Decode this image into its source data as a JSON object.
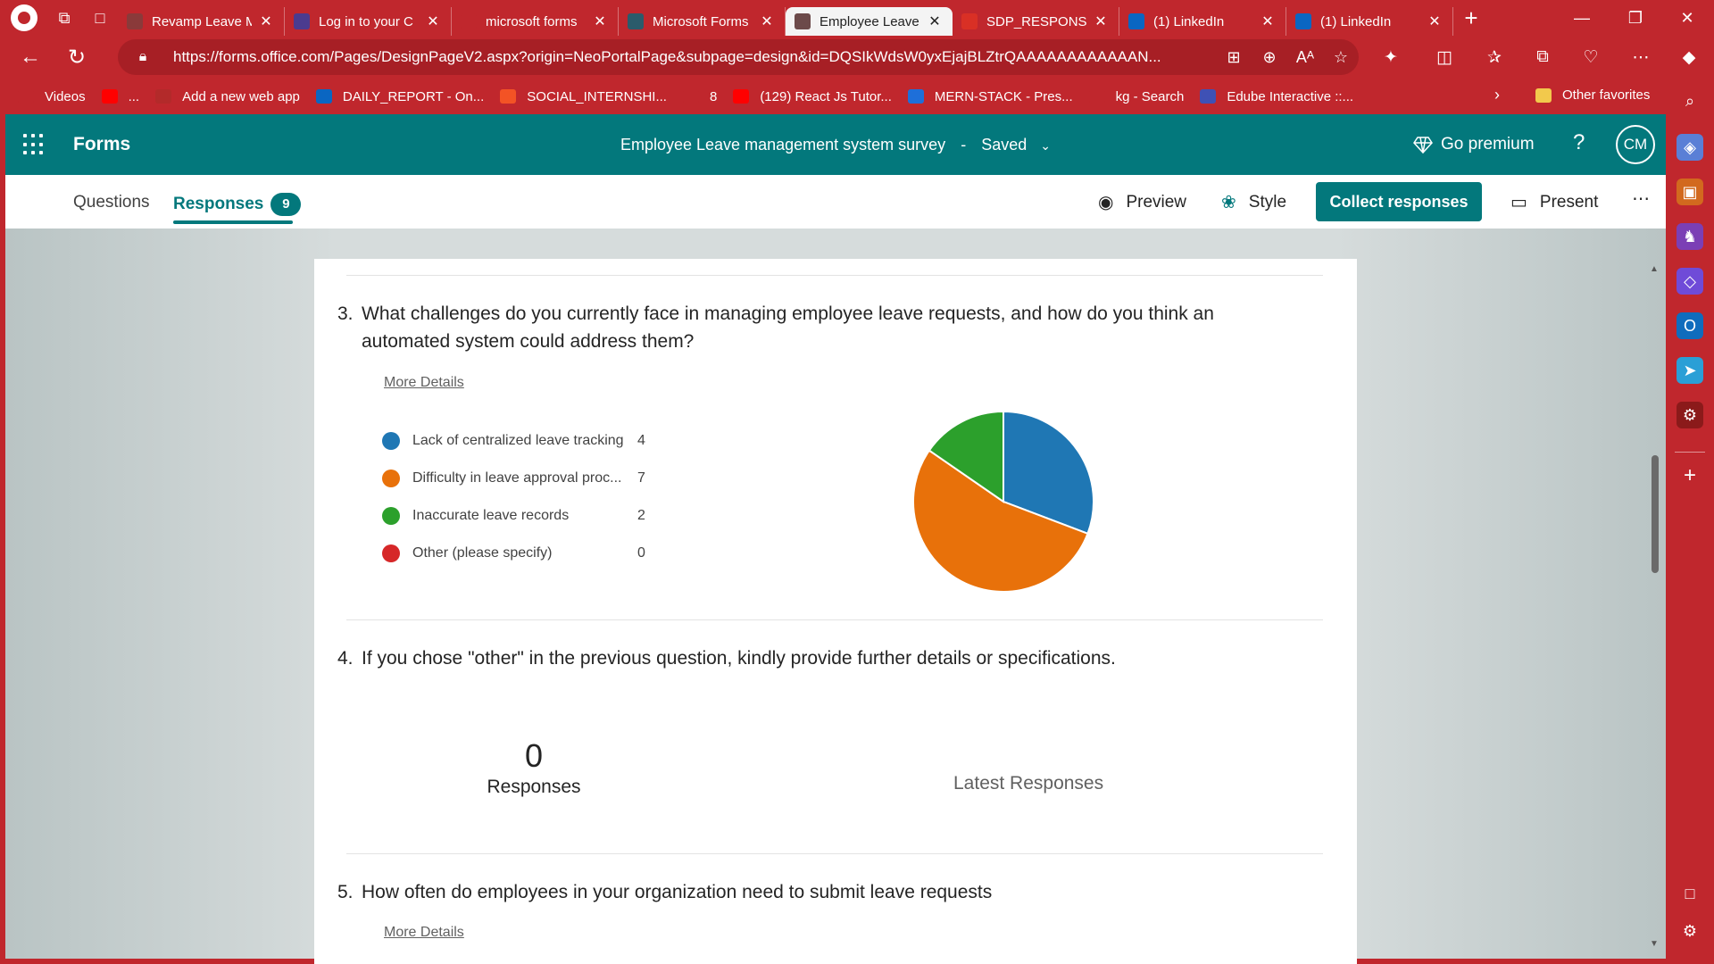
{
  "browser": {
    "tabs": [
      {
        "title": "Revamp Leave M",
        "favicon_color": "#8a3a3a",
        "active": false
      },
      {
        "title": "Log in to your C",
        "favicon_color": "#4b3b8f",
        "active": false
      },
      {
        "title": "microsoft forms",
        "favicon_color": "#c0272d",
        "active": false
      },
      {
        "title": "Microsoft Forms",
        "favicon_color": "#2b5b6b",
        "active": false
      },
      {
        "title": "Employee Leave",
        "favicon_color": "#6c4a4a",
        "active": true
      },
      {
        "title": "SDP_RESPONSE",
        "favicon_color": "#d93025",
        "active": false
      },
      {
        "title": "(1) LinkedIn",
        "favicon_color": "#0a66c2",
        "active": false
      },
      {
        "title": "(1) LinkedIn",
        "favicon_color": "#0a66c2",
        "active": false
      }
    ],
    "url": "https://forms.office.com/Pages/DesignPageV2.aspx?origin=NeoPortalPage&subpage=design&id=DQSIkWdsW0yxEjajBLZtrQAAAAAAAAAAAAN...",
    "favorites": [
      {
        "label": "Videos",
        "icon_color": "#c0272d"
      },
      {
        "label": "...",
        "icon_color": "#ff0000"
      },
      {
        "label": "Add a new web app",
        "icon_color": "#b32a2a"
      },
      {
        "label": "DAILY_REPORT - On...",
        "icon_color": "#0a66c2"
      },
      {
        "label": "SOCIAL_INTERNSHI...",
        "icon_color": "#f35325"
      },
      {
        "label": "8",
        "icon_color": "#c0272d"
      },
      {
        "label": "(129) React Js Tutor...",
        "icon_color": "#ff0000"
      },
      {
        "label": "MERN-STACK - Pres...",
        "icon_color": "#1e6fd9"
      },
      {
        "label": "kg - Search",
        "icon_color": "#c0272d"
      },
      {
        "label": "Edube Interactive ::...",
        "icon_color": "#3f51b5"
      }
    ],
    "other_favorites": "Other favorites"
  },
  "forms": {
    "app_name": "Forms",
    "form_title": "Employee Leave management system survey",
    "save_status": "Saved",
    "go_premium": "Go premium",
    "help": "?",
    "avatar_initials": "CM",
    "tabs": {
      "questions": "Questions",
      "responses": "Responses",
      "responses_count": "9"
    },
    "commands": {
      "preview": "Preview",
      "style": "Style",
      "collect": "Collect responses",
      "present": "Present"
    }
  },
  "questions": [
    {
      "number": "3.",
      "text": "What challenges do you currently face in managing employee leave requests, and how do you think an automated system could address them?",
      "more_details": "More Details"
    },
    {
      "number": "4.",
      "text": "If you chose \"other\" in the previous question, kindly provide further details or specifications.",
      "responses_count": "0",
      "responses_label": "Responses",
      "latest_label": "Latest Responses"
    },
    {
      "number": "5.",
      "text": "How often do employees in your organization need to submit leave requests",
      "more_details": "More Details"
    }
  ],
  "chart_data": {
    "type": "pie",
    "categories": [
      "Lack of centralized leave tracking",
      "Difficulty in leave approval proc...",
      "Inaccurate leave records",
      "Other (please specify)"
    ],
    "values": [
      4,
      7,
      2,
      0
    ],
    "colors": [
      "#1f77b4",
      "#e8710a",
      "#2ca02c",
      "#d62728"
    ],
    "legend_position": "left"
  }
}
